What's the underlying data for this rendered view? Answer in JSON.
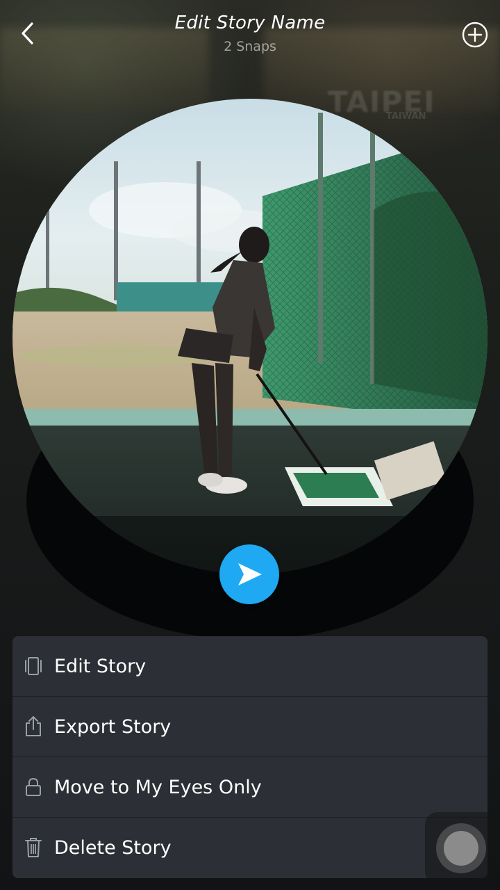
{
  "header": {
    "title": "Edit Story Name",
    "subtitle": "2 Snaps",
    "back_icon": "chevron-left-icon",
    "add_icon": "plus-circle-icon"
  },
  "background_text": {
    "city": "TAIPEI",
    "country": "TAIWAN"
  },
  "media": {
    "play_icon": "play-arrow-icon",
    "play_color": "#1ea9f2"
  },
  "menu": {
    "items": [
      {
        "label": "Edit Story",
        "icon": "story-frames-icon"
      },
      {
        "label": "Export Story",
        "icon": "share-export-icon"
      },
      {
        "label": "Move to My Eyes Only",
        "icon": "lock-icon"
      },
      {
        "label": "Delete Story",
        "icon": "trash-icon"
      }
    ]
  },
  "colors": {
    "sheet_background": "#2c2f35",
    "accent": "#1ea9f2"
  }
}
